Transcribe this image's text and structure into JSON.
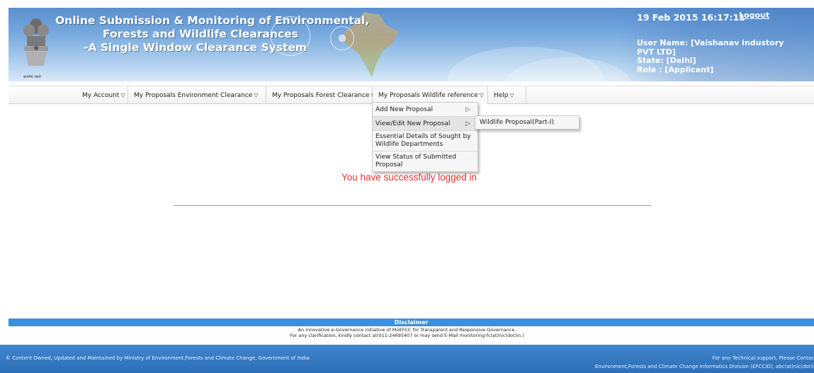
{
  "header": {
    "title_line1": "Online Submission & Monitoring of Environmental,",
    "title_line2": "Forests and Wildlife Clearances",
    "title_line3": "-A Single Window Clearance System",
    "emblem_caption": "सत्यमेव जयते",
    "datetime": "19 Feb 2015 16:17:11",
    "logout_label": "Logout",
    "user_name_line1": "User Name: [Vaishanav industory",
    "user_name_line2": "PVT LTD]",
    "state": "State: [Delhi]",
    "role": "Role : [Applicant]"
  },
  "menu": {
    "items": [
      {
        "label": "My Account"
      },
      {
        "label": "My Proposals Environment Clearance"
      },
      {
        "label": "My Proposals Forest Clearance"
      },
      {
        "label": "My Proposals Wildlife reference"
      },
      {
        "label": "Help"
      }
    ],
    "arrow_glyph": "▽"
  },
  "dropdown": {
    "items": [
      {
        "label": "Add New Proposal",
        "arrow": "▷"
      },
      {
        "label": "View/Edit New Proposal",
        "arrow": "▷"
      },
      {
        "label": "Essential Details of Sought by Wildlife Departments"
      },
      {
        "label": "View Status of Submitted Proposal"
      }
    ],
    "submenu_label": "Wildlife Proposal(Part-I)"
  },
  "main": {
    "success_message": "You have successfully logged in"
  },
  "disclaimer": {
    "title": "Disclaimer",
    "line1": "An innovative e-Governance initiative of MoEFCC for Transparent and Responsive Governance.",
    "line2": "For any clarification, kindly contact at(011-24695407 or may send E-Mail monitoring-fc(at)nic(dot)in.)"
  },
  "footer": {
    "left": "© Content Owned, Updated and Maintained by Ministry of Environment,Forests and Climate Change, Government of India",
    "right1": "For any Technical support, Please Contac",
    "right2": "Environment,Forests and Climate Change Informatics Division (EFCCID), abc(at)nic(dot)i"
  },
  "colors": {
    "banner_blue": "#5a8fd0",
    "message_red": "#e0332f",
    "disclaimer_blue": "#3f8fd8",
    "footer_blue": "#2d6fb8"
  },
  "icons": [
    "national-emblem-icon",
    "chevron-down-icon",
    "chevron-right-icon"
  ]
}
